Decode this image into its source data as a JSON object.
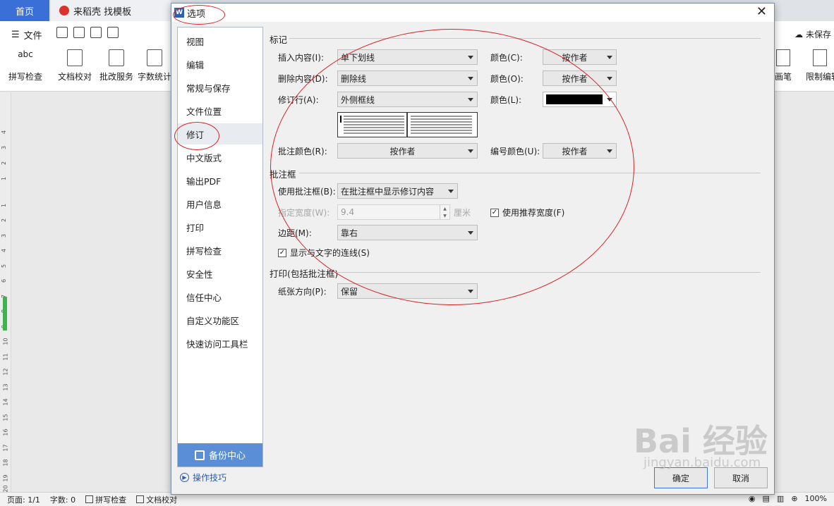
{
  "background_app": {
    "tabs": [
      {
        "label": "首页"
      },
      {
        "label": "来稻壳 找模板"
      }
    ],
    "file_menu": "文件",
    "ribbon_buttons": [
      "拼写检查",
      "文档校对",
      "批改服务",
      "字数统计"
    ],
    "ribbon_right": [
      "画笔",
      "限制编辑"
    ],
    "save_status": "未保存",
    "ribbon_sample_text": "abc",
    "ruler_numbers": [
      "4",
      "3",
      "2",
      "1",
      "1",
      "2",
      "3",
      "4",
      "5",
      "6",
      "7",
      "8",
      "9",
      "10",
      "11",
      "12",
      "13",
      "14",
      "15",
      "16",
      "17",
      "18",
      "19",
      "20"
    ],
    "statusbar": {
      "page": "页面: 1/1",
      "words": "字数: 0",
      "spell": "拼写检查",
      "proof": "文档校对",
      "zoom": "100%"
    }
  },
  "dialog": {
    "title": "选项",
    "app_icon_letter": "W",
    "nav_items": [
      {
        "label": "视图"
      },
      {
        "label": "编辑"
      },
      {
        "label": "常规与保存"
      },
      {
        "label": "文件位置"
      },
      {
        "label": "修订",
        "active": true
      },
      {
        "label": "中文版式"
      },
      {
        "label": "输出PDF"
      },
      {
        "label": "用户信息"
      },
      {
        "label": "打印"
      },
      {
        "label": "拼写检查"
      },
      {
        "label": "安全性"
      },
      {
        "label": "信任中心"
      },
      {
        "label": "自定义功能区"
      },
      {
        "label": "快速访问工具栏"
      }
    ],
    "backup_center": "备份中心",
    "tips_link": "操作技巧",
    "sections": {
      "marks": {
        "title": "标记",
        "insert_label": "插入内容(I):",
        "insert_value": "单下划线",
        "insert_color_label": "颜色(C):",
        "insert_color_value": "按作者",
        "delete_label": "删除内容(D):",
        "delete_value": "删除线",
        "delete_color_label": "颜色(O):",
        "delete_color_value": "按作者",
        "revline_label": "修订行(A):",
        "revline_value": "外侧框线",
        "revline_color_label": "颜色(L):",
        "revline_color_value": "#000000",
        "comment_color_label": "批注颜色(R):",
        "comment_color_value": "按作者",
        "number_color_label": "编号颜色(U):",
        "number_color_value": "按作者"
      },
      "balloons": {
        "title": "批注框",
        "use_label": "使用批注框(B):",
        "use_value": "在批注框中显示修订内容",
        "width_label": "指定宽度(W):",
        "width_value": "9.4",
        "width_unit": "厘米",
        "recommended_label": "使用推荐宽度(F)",
        "recommended_checked": true,
        "margin_label": "边距(M):",
        "margin_value": "靠右",
        "connect_label": "显示与文字的连线(S)",
        "connect_checked": true
      },
      "print": {
        "title": "打印(包括批注框)",
        "orientation_label": "纸张方向(P):",
        "orientation_value": "保留"
      }
    },
    "ok_button": "确定",
    "cancel_button": "取消"
  },
  "watermark": {
    "text": "Bai 经验",
    "sub": "jingyan.baidu.com"
  },
  "colors": {
    "accent": "#3b6fd8",
    "annotation": "#dd2222",
    "backup": "#5a8fd8"
  }
}
